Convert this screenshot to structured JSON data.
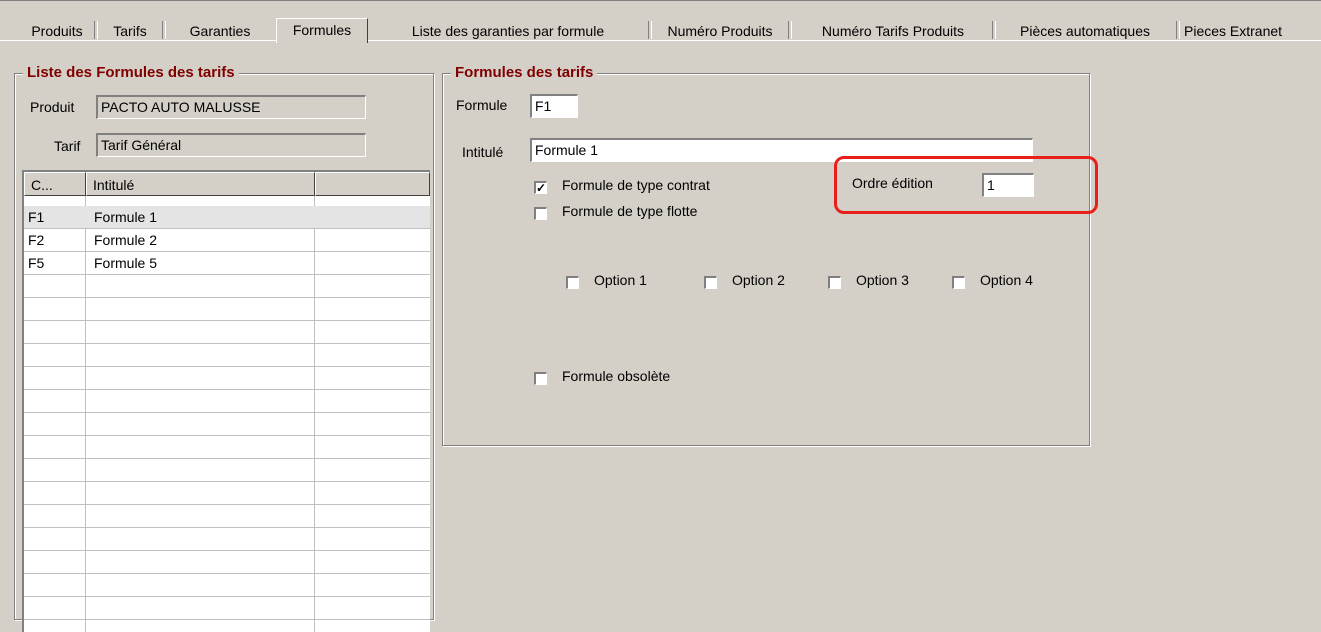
{
  "tabs": [
    {
      "label": "Produits"
    },
    {
      "label": "Tarifs"
    },
    {
      "label": "Garanties"
    },
    {
      "label": "Formules"
    },
    {
      "label": "Liste des garanties par formule"
    },
    {
      "label": "Numéro Produits"
    },
    {
      "label": "Numéro Tarifs Produits"
    },
    {
      "label": "Pièces automatiques"
    },
    {
      "label": "Pieces  Extranet"
    }
  ],
  "left": {
    "legend": "Liste des Formules des tarifs",
    "produit_label": "Produit",
    "produit_value": "PACTO AUTO MALUSSE",
    "tarif_label": "Tarif",
    "tarif_value": "Tarif Général",
    "grid": {
      "headers": [
        "C...",
        "Intitulé",
        ""
      ],
      "rows": [
        {
          "code": "F1",
          "intitule": "Formule 1",
          "selected": true
        },
        {
          "code": "F2",
          "intitule": "Formule 2",
          "selected": false
        },
        {
          "code": "F5",
          "intitule": "Formule 5",
          "selected": false
        }
      ]
    }
  },
  "right": {
    "legend": "Formules des tarifs",
    "formule_label": "Formule",
    "formule_value": "F1",
    "intitule_label": "Intitulé",
    "intitule_value": "Formule 1",
    "contrat_label": "Formule de type contrat",
    "contrat_checked": true,
    "flotte_label": "Formule de type flotte",
    "flotte_checked": false,
    "ordre_label": "Ordre édition",
    "ordre_value": "1",
    "options": [
      {
        "label": "Option 1",
        "checked": false
      },
      {
        "label": "Option 2",
        "checked": false
      },
      {
        "label": "Option 3",
        "checked": false
      },
      {
        "label": "Option 4",
        "checked": false
      }
    ],
    "obsolete_label": "Formule obsolète",
    "obsolete_checked": false
  },
  "colors": {
    "legend": "#800000",
    "highlight": "#e8201c",
    "background": "#d4d0c8"
  }
}
